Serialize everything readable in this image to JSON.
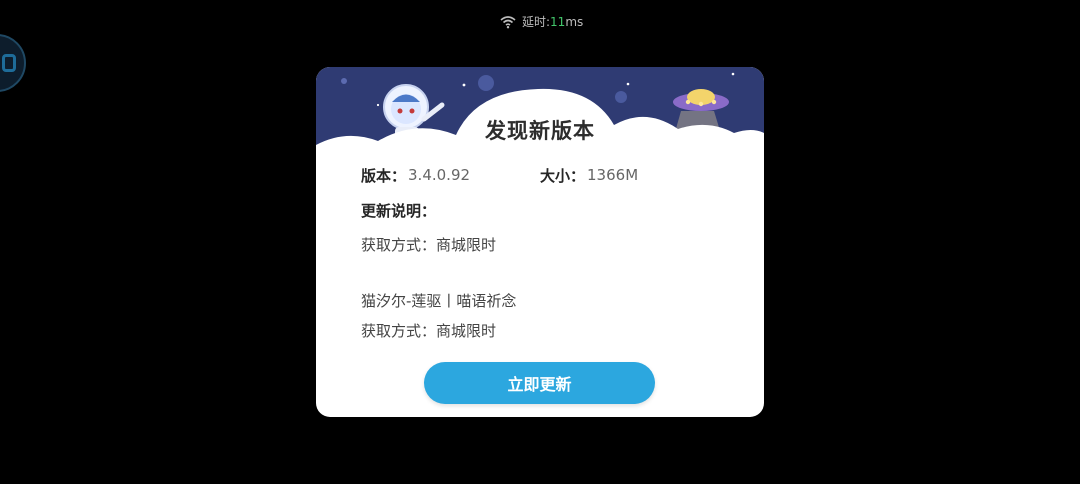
{
  "status": {
    "latency_label": "延时:",
    "latency_value": "11",
    "latency_unit": "ms",
    "wifi_icon": "wifi-icon"
  },
  "dialog": {
    "title": "发现新版本",
    "version_label": "版本：",
    "version_value": "3.4.0.92",
    "size_label": "大小：",
    "size_value": "1366M",
    "notes_label": "更新说明：",
    "notes": [
      "获取方式：商城限时",
      "猫汐尔-莲驱丨喵语祈念",
      "获取方式：商城限时"
    ],
    "update_button": "立即更新"
  },
  "colors": {
    "accent": "#2ca7df",
    "latency": "#42c66b",
    "banner": "#2f3b73"
  }
}
